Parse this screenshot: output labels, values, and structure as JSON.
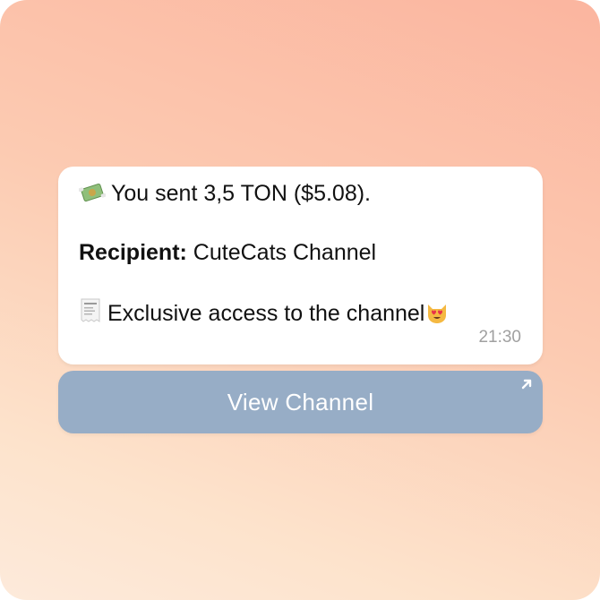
{
  "message": {
    "line1_icon": "money-with-wings-icon",
    "line1_text": "You sent 3,5 TON ($5.08).",
    "recipient_label": "Recipient:",
    "recipient_name": " CuteCats Channel",
    "line3_icon": "receipt-icon",
    "line3_text": "Exclusive access to the channel",
    "line3_end_icon": "heart-eyes-cat-icon",
    "time": "21:30"
  },
  "button": {
    "label": "View Channel",
    "icon": "external-arrow-icon"
  },
  "colors": {
    "bubble_bg": "#ffffff",
    "button_bg": "#97adc6",
    "timestamp": "#a0a0a0"
  }
}
